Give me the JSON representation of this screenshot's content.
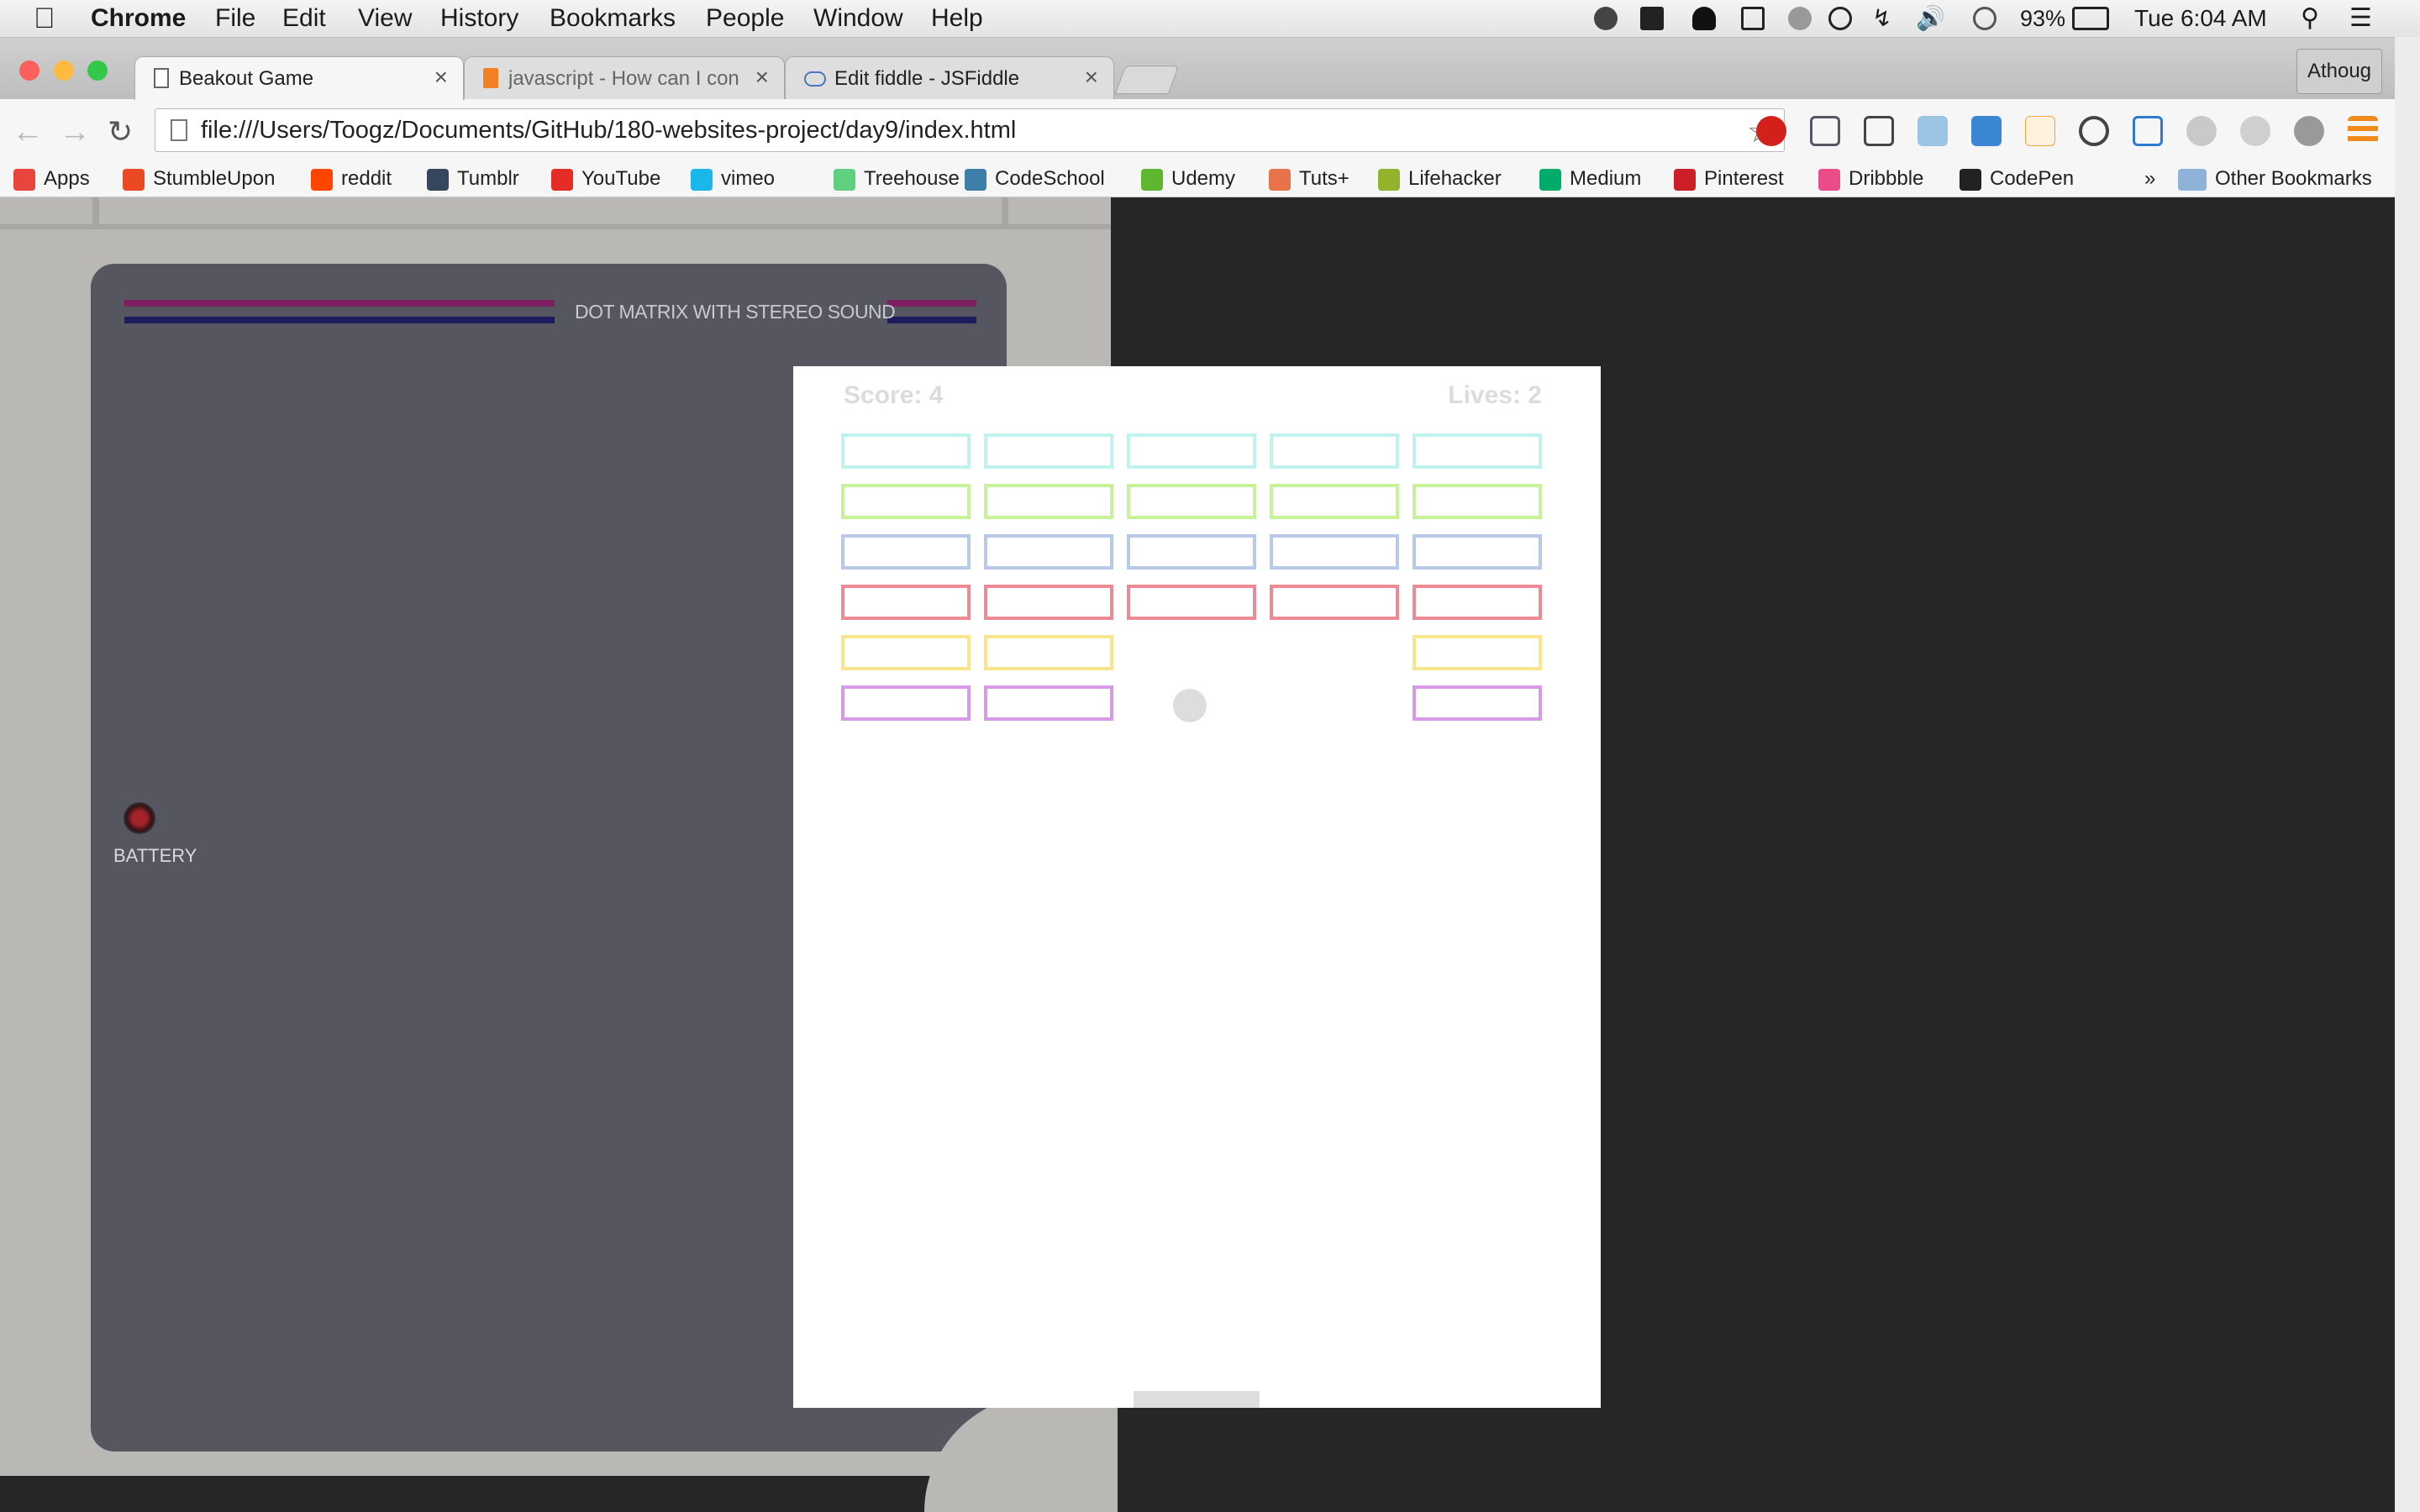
{
  "menubar": {
    "app_name": "Chrome",
    "items": [
      "File",
      "Edit",
      "View",
      "History",
      "Bookmarks",
      "People",
      "Window",
      "Help"
    ],
    "battery": "93%",
    "clock": "Tue 6:04 AM"
  },
  "tabs": [
    {
      "label": "Beakout Game",
      "active": true
    },
    {
      "label": "javascript - How can I con",
      "active": false
    },
    {
      "label": "Edit fiddle - JSFiddle",
      "active": false
    }
  ],
  "profile_name": "Athoug",
  "address_bar": {
    "url": "file:///Users/Toogz/Documents/GitHub/180-websites-project/day9/index.html"
  },
  "bookmarks": [
    {
      "label": "Apps",
      "color": "#e8453c"
    },
    {
      "label": "StumbleUpon",
      "color": "#eb4924"
    },
    {
      "label": "reddit",
      "color": "#ff4500"
    },
    {
      "label": "Tumblr",
      "color": "#36465d"
    },
    {
      "label": "YouTube",
      "color": "#e52d27"
    },
    {
      "label": "vimeo",
      "color": "#1ab7ea"
    },
    {
      "label": "Treehouse",
      "color": "#5fcf80"
    },
    {
      "label": "CodeSchool",
      "color": "#3d7fa8"
    },
    {
      "label": "Udemy",
      "color": "#5fb730"
    },
    {
      "label": "Tuts+",
      "color": "#e8734a"
    },
    {
      "label": "Lifehacker",
      "color": "#94b32c"
    },
    {
      "label": "Medium",
      "color": "#00ab6c"
    },
    {
      "label": "Pinterest",
      "color": "#cb2027"
    },
    {
      "label": "Dribbble",
      "color": "#ea4c89"
    },
    {
      "label": "CodePen",
      "color": "#222222"
    }
  ],
  "bookmarks_overflow": "»",
  "other_bookmarks": "Other Bookmarks",
  "console": {
    "brand_text": "DOT MATRIX WITH STEREO SOUND",
    "battery_label": "BATTERY",
    "stripe_colors": [
      "#7d1f60",
      "#1c1b5c"
    ]
  },
  "game": {
    "score_text": "Score: 4",
    "lives_text": "Lives: 2",
    "brick_rows": [
      {
        "color": "#c0f2ee",
        "present": [
          true,
          true,
          true,
          true,
          true
        ]
      },
      {
        "color": "#c6f39a",
        "present": [
          true,
          true,
          true,
          true,
          true
        ]
      },
      {
        "color": "#b9c9e8",
        "present": [
          true,
          true,
          true,
          true,
          true
        ]
      },
      {
        "color": "#ee8a96",
        "present": [
          true,
          true,
          true,
          true,
          true
        ]
      },
      {
        "color": "#f8e58c",
        "present": [
          true,
          true,
          false,
          false,
          true
        ]
      },
      {
        "color": "#d69ae6",
        "present": [
          true,
          true,
          false,
          false,
          true
        ]
      }
    ],
    "ball_color": "#dddddd",
    "paddle_color": "#dddddd"
  }
}
